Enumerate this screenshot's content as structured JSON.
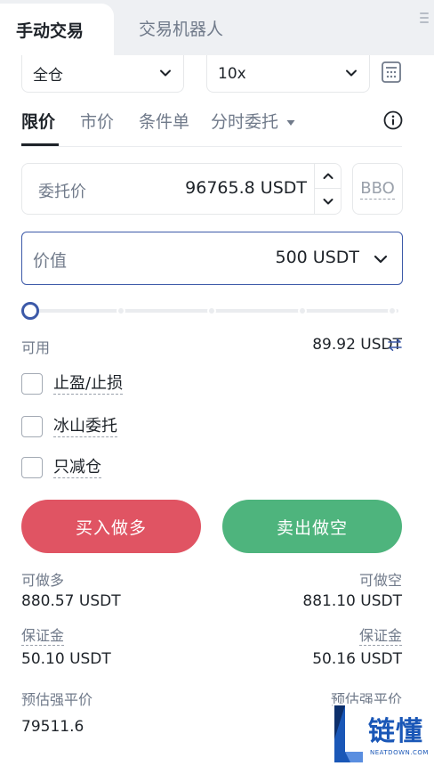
{
  "tabs": {
    "active": "手动交易",
    "inactive": "交易机器人"
  },
  "margin_mode": "全仓",
  "leverage": "10x",
  "order_tabs": [
    "限价",
    "市价",
    "条件单",
    "分时委托"
  ],
  "price": {
    "label": "委托价",
    "value": "96765.8 USDT",
    "bbo": "BBO"
  },
  "value": {
    "label": "价值",
    "amount": "500 USDT"
  },
  "slider": {
    "percent": 0,
    "stops": [
      0,
      25,
      50,
      75,
      100
    ]
  },
  "available": {
    "label": "可用",
    "value": "89.92 USDT"
  },
  "options": [
    "止盈/止损",
    "冰山委托",
    "只减仓"
  ],
  "buttons": {
    "buy": "买入做多",
    "sell": "卖出做空"
  },
  "stats": {
    "long_max_label": "可做多",
    "long_max_value": "880.57 USDT",
    "short_max_label": "可做空",
    "short_max_value": "881.10 USDT",
    "margin_label_left": "保证金",
    "margin_value_left": "50.10 USDT",
    "margin_label_right": "保证金",
    "margin_value_right": "50.16 USDT",
    "liq_label_left": "预估强平价",
    "liq_value_left": "79511.6",
    "liq_label_right": "预估强平价"
  },
  "watermark": {
    "text": "链懂",
    "sub": "NEATDOWN.COM"
  },
  "colors": {
    "buy": "#e05463",
    "sell": "#4eb47d",
    "accent": "#3c59a8"
  }
}
